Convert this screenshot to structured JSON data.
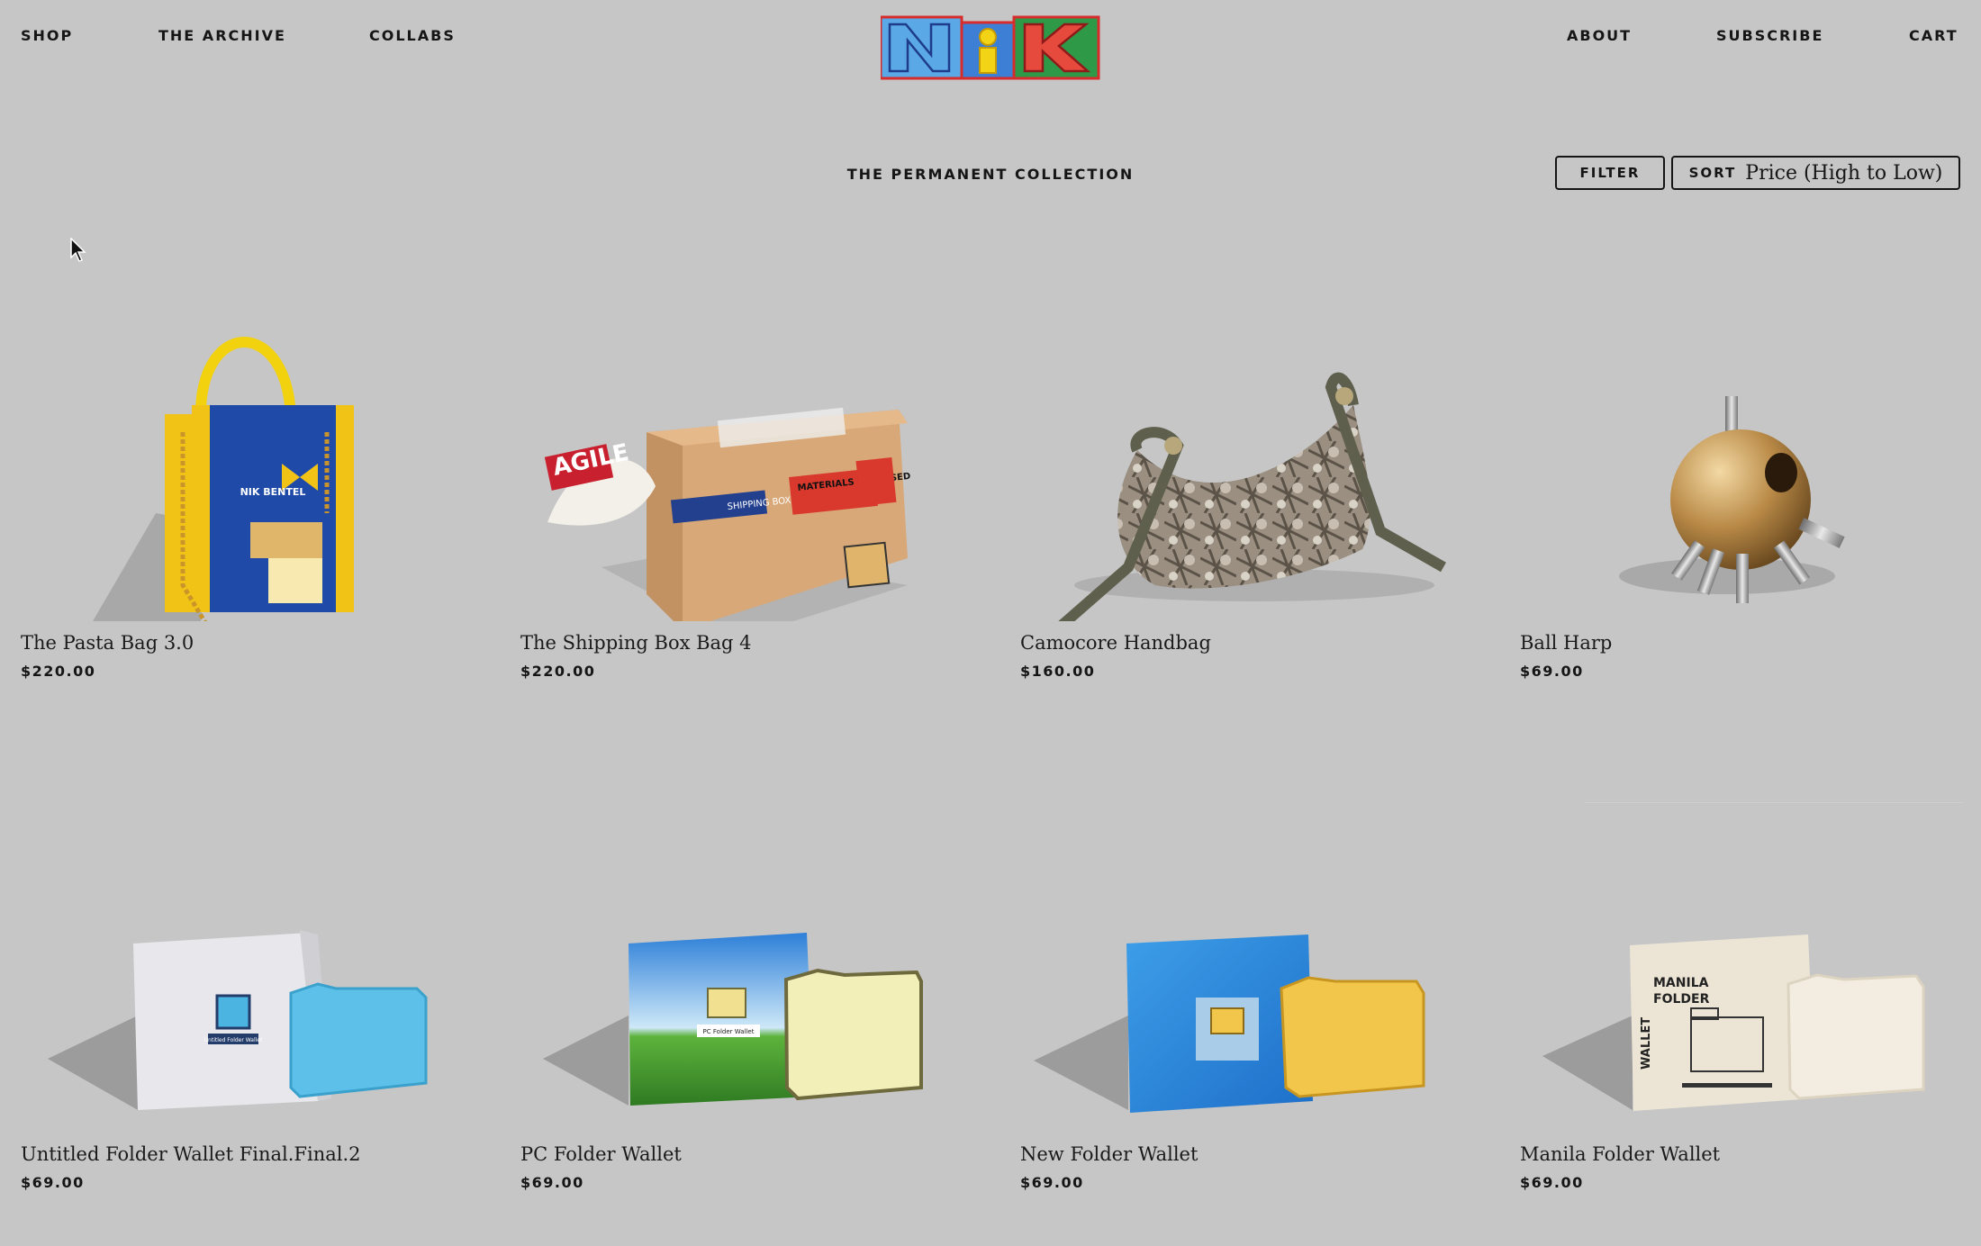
{
  "nav": {
    "shop": "SHOP",
    "archive": "THE ARCHIVE",
    "collabs": "COLLABS",
    "about": "ABOUT",
    "subscribe": "SUBSCRIBE",
    "cart": "CART"
  },
  "logo": {
    "text": "NiK",
    "colors": {
      "n": "#5aa9e6",
      "i": "#f3d316",
      "k": "#e64a3c",
      "frame": "#2e9a47",
      "outline": "#d62c2c"
    }
  },
  "collection": {
    "title": "THE PERMANENT COLLECTION"
  },
  "controls": {
    "filter_label": "FILTER",
    "sort_label": "SORT",
    "sort_value": "Price (High to Low)"
  },
  "products": [
    {
      "name": "The Pasta Bag 3.0",
      "price": "$220.00",
      "icon": "pasta-bag-image"
    },
    {
      "name": "The Shipping Box Bag 4",
      "price": "$220.00",
      "icon": "shipping-box-bag-image"
    },
    {
      "name": "Camocore Handbag",
      "price": "$160.00",
      "icon": "camo-handbag-image"
    },
    {
      "name": "Ball Harp",
      "price": "$69.00",
      "icon": "ball-harp-image"
    },
    {
      "name": "Untitled Folder Wallet Final.Final.2",
      "price": "$69.00",
      "icon": "folder-wallet-image"
    },
    {
      "name": "PC Folder Wallet",
      "price": "$69.00",
      "icon": "pc-folder-wallet-image"
    },
    {
      "name": "New Folder Wallet",
      "price": "$69.00",
      "icon": "new-folder-wallet-image"
    },
    {
      "name": "Manila Folder Wallet",
      "price": "$69.00",
      "icon": "manila-folder-wallet-image"
    }
  ],
  "product_art": {
    "pasta_box_label": "NIK BENTEL",
    "shipping_tape": "AGILE",
    "shipping_label": "SHIPPING BOX BAG",
    "shipping_sticker": "MATERIALS ENCLOSED",
    "untitled_box_label": "Untitled Folder Wallet",
    "pc_box_label": "PC Folder Wallet",
    "manila_box_line1": "MANILA",
    "manila_box_line2": "FOLDER",
    "manila_box_side": "WALLET"
  },
  "colors": {
    "background": "#c6c6c6",
    "text": "#151515",
    "pasta_blue": "#1f4aa8",
    "pasta_yellow": "#f2c317",
    "cardboard": "#d8a878",
    "folder_blue": "#5cc0e8",
    "folder_yellow": "#f2c64a",
    "cream": "#ece5d6"
  }
}
